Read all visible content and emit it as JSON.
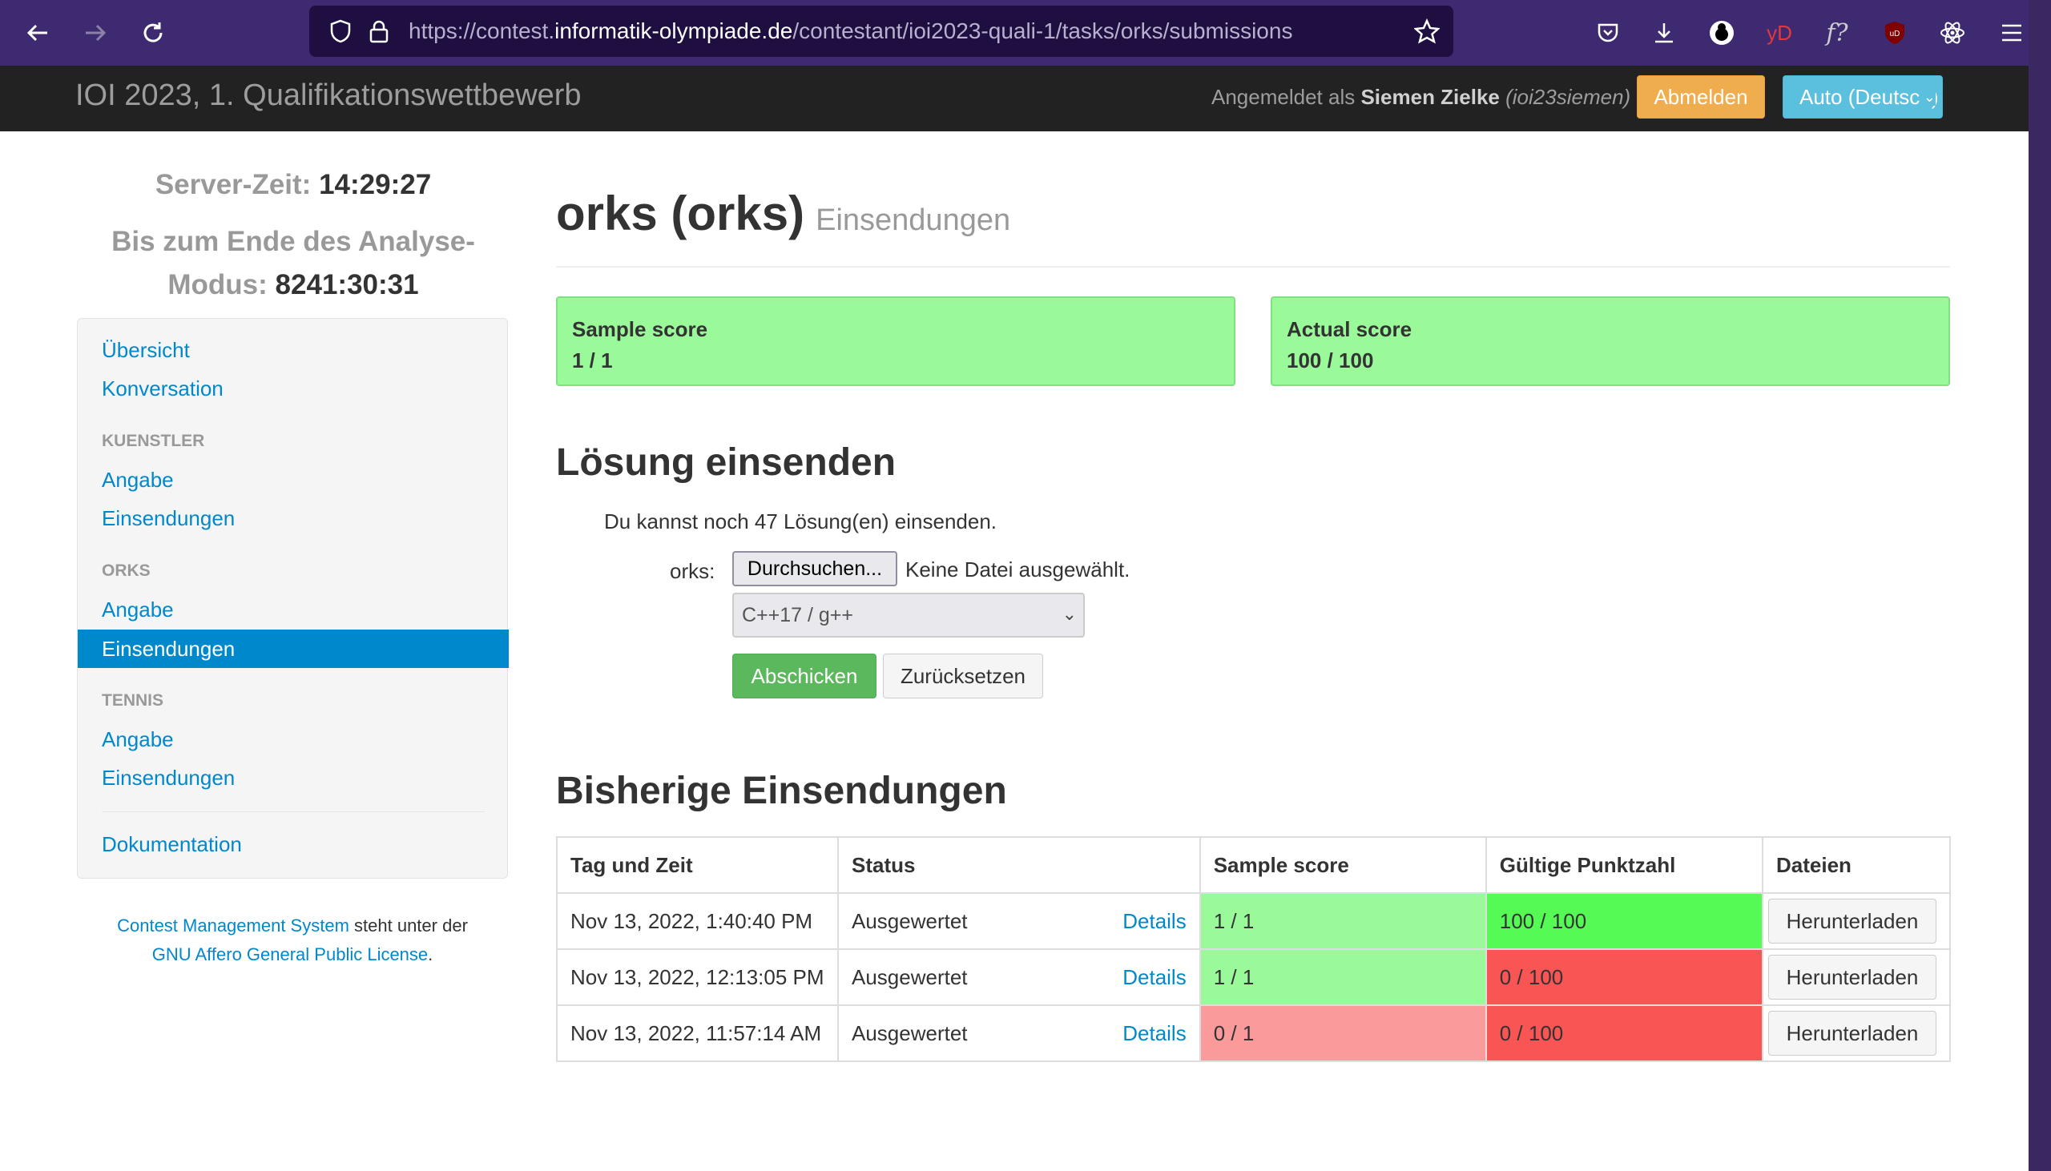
{
  "browser": {
    "url_prefix": "https://contest.",
    "url_domain": "informatik-olympiade.de",
    "url_path": "/contestant/ioi2023-quali-1/tasks/orks/submissions",
    "ext_yd": "yD",
    "ext_f": "f?",
    "ext_ub": "uD"
  },
  "nav": {
    "brand": "IOI 2023, 1. Qualifikationswettbewerb",
    "logged_prefix": "Angemeldet als",
    "user_name": "Siemen Zielke",
    "user_login": "(ioi23siemen)",
    "logout": "Abmelden",
    "language": "Auto (Deutsch)"
  },
  "sidebar": {
    "server_time_label": "Server-Zeit:",
    "server_time": "14:29:27",
    "remaining_label_1": "Bis zum Ende des Analyse-",
    "remaining_label_2": "Modus:",
    "remaining": "8241:30:31",
    "overview": "Übersicht",
    "conversation": "Konversation",
    "sections": [
      {
        "head": "KUENSTLER",
        "statement": "Angabe",
        "submissions": "Einsendungen"
      },
      {
        "head": "ORKS",
        "statement": "Angabe",
        "submissions": "Einsendungen"
      },
      {
        "head": "TENNIS",
        "statement": "Angabe",
        "submissions": "Einsendungen"
      }
    ],
    "documentation": "Dokumentation",
    "footer_link1": "Contest Management System",
    "footer_mid": "steht unter der",
    "footer_link2": "GNU Affero General Public License",
    "footer_end": "."
  },
  "main": {
    "title": "orks (orks)",
    "subtitle": "Einsendungen",
    "sample_score_label": "Sample score",
    "sample_score": "1 / 1",
    "actual_score_label": "Actual score",
    "actual_score": "100 / 100",
    "submit_heading": "Lösung einsenden",
    "remaining_text": "Du kannst noch 47 Lösung(en) einsenden.",
    "file_label": "orks:",
    "browse": "Durchsuchen...",
    "no_file": "Keine Datei ausgewählt.",
    "language_selected": "C++17 / g++",
    "submit": "Abschicken",
    "reset": "Zurücksetzen",
    "previous_heading": "Bisherige Einsendungen",
    "columns": [
      "Tag und Zeit",
      "Status",
      "Sample score",
      "Gültige Punktzahl",
      "Dateien"
    ],
    "rows": [
      {
        "time": "Nov 13, 2022, 1:40:40 PM",
        "status": "Ausgewertet",
        "details": "Details",
        "sample": "1 / 1",
        "score": "100 / 100",
        "download": "Herunterladen"
      },
      {
        "time": "Nov 13, 2022, 12:13:05 PM",
        "status": "Ausgewertet",
        "details": "Details",
        "sample": "1 / 1",
        "score": "0 / 100",
        "download": "Herunterladen"
      },
      {
        "time": "Nov 13, 2022, 11:57:14 AM",
        "status": "Ausgewertet",
        "details": "Details",
        "sample": "0 / 1",
        "score": "0 / 100",
        "download": "Herunterladen"
      }
    ]
  }
}
